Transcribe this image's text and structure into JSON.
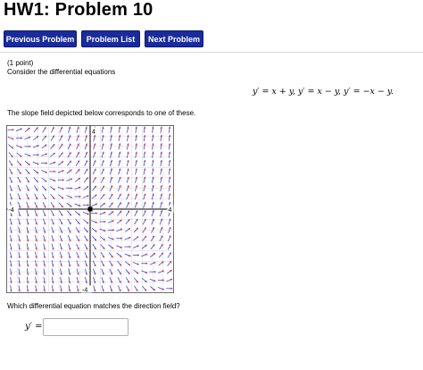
{
  "header": {
    "title": "HW1: Problem 10"
  },
  "nav": {
    "previous_label": "Previous Problem",
    "list_label": "Problem List",
    "next_label": "Next Problem"
  },
  "problem": {
    "points": "(1 point)",
    "intro": "Consider the differential equations",
    "equations": "y′ = x + y,  y′ = x − y,  y′ = −x − y.",
    "field_caption": "The slope field depicted below corresponds to one of these.",
    "question": "Which differential equation matches the direction field?",
    "answer_label": "y′ =",
    "answer_value": ""
  },
  "chart_data": {
    "type": "slope-field",
    "xlim": [
      -4,
      4
    ],
    "ylim": [
      -4,
      4
    ],
    "grid": true,
    "axis_labels": {
      "x_min": "-4",
      "x_max": "4",
      "y_min": "-4",
      "y_max": "4"
    },
    "arrow_color": "#1d2fe0",
    "arrow_tip_color": "#e0203a",
    "slope": "x + y"
  }
}
